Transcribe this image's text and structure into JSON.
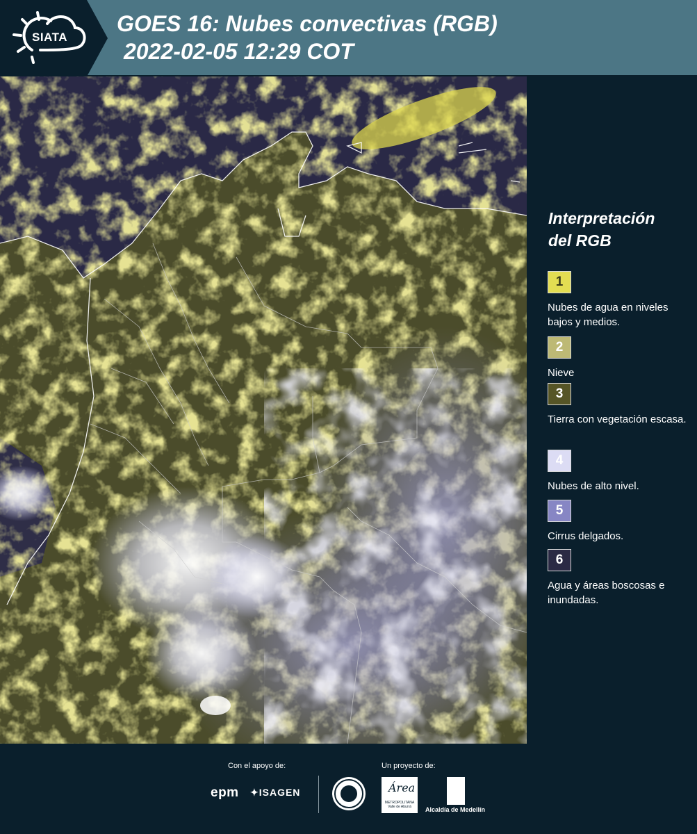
{
  "header": {
    "logo_text": "SIATA",
    "title_line1": "GOES 16: Nubes convectivas (RGB)",
    "title_line2": "2022-02-05 12:29 COT"
  },
  "legend": {
    "title_line1": "Interpretación",
    "title_line2": "del RGB",
    "items": [
      {
        "number": "1",
        "label": "Nubes de agua en niveles bajos y medios.",
        "color": "#e3dd52",
        "text_color": "#3a3a1a"
      },
      {
        "number": "2",
        "label": "Nieve",
        "color": "#bdb975",
        "text_color": "#ffffff"
      },
      {
        "number": "3",
        "label": "Tierra con vegetación escasa.",
        "color": "#565526",
        "text_color": "#ffffff"
      },
      {
        "number": "4",
        "label": "Nubes de alto nivel.",
        "color": "#dcdcf4",
        "text_color": "#ffffff"
      },
      {
        "number": "5",
        "label": "Cirrus delgados.",
        "color": "#8786c4",
        "text_color": "#ffffff"
      },
      {
        "number": "6",
        "label": "Agua y áreas boscosas e inundadas.",
        "color": "#2b2a44",
        "text_color": "#ffffff"
      }
    ]
  },
  "footer": {
    "support_label": "Con el apoyo de:",
    "project_label": "Un proyecto de:",
    "sponsor1": "epm",
    "sponsor2": "ISAGEN",
    "area_word": "Área",
    "area_sub": "METROPOLITANA Valle de Aburrá",
    "alcaldia": "Alcaldía de Medellín"
  },
  "colors": {
    "header_band": "#4c7685",
    "background": "#0a1f2c",
    "ocean": "#2b2a4a",
    "land": "#4a4b2c",
    "low_cloud": "#d8d24c",
    "high_cloud": "#e4e4f6",
    "cirrus": "#8a89c6"
  }
}
